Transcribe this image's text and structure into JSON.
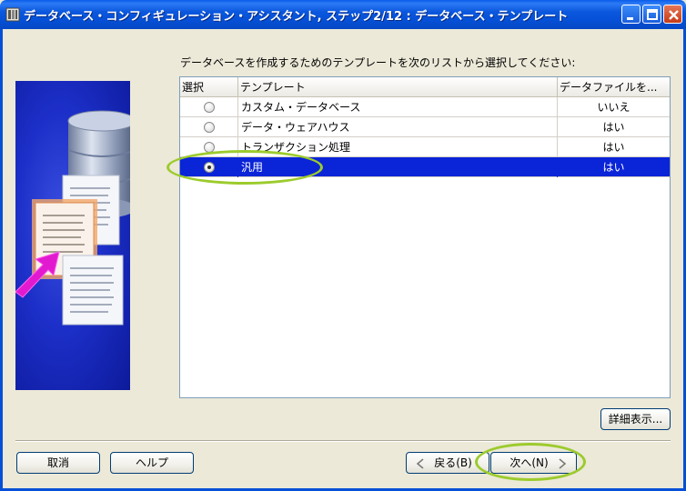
{
  "window": {
    "title": "データベース・コンフィギュレーション・アシスタント, ステップ2/12 : データベース・テンプレート"
  },
  "prompt": "データベースを作成するためのテンプレートを次のリストから選択してください:",
  "table": {
    "columns": [
      "選択",
      "テンプレート",
      "データファイルを..."
    ],
    "rows": [
      {
        "selected": false,
        "name": "カスタム・データベース",
        "datafiles": "いいえ"
      },
      {
        "selected": false,
        "name": "データ・ウェアハウス",
        "datafiles": "はい"
      },
      {
        "selected": false,
        "name": "トランザクション処理",
        "datafiles": "はい"
      },
      {
        "selected": true,
        "name": "汎用",
        "datafiles": "はい"
      }
    ]
  },
  "buttons": {
    "details": "詳細表示...",
    "cancel": "取消",
    "help": "ヘルプ",
    "back": "戻る(B)",
    "next": "次へ(N)"
  },
  "colors": {
    "selection": "#0A24D8",
    "annotation": "#9CCB2C",
    "titlebar": "#0550D6"
  },
  "icons": [
    "app-icon",
    "minimize-icon",
    "maximize-icon",
    "close-icon",
    "chevron-left-icon",
    "chevron-right-icon"
  ]
}
